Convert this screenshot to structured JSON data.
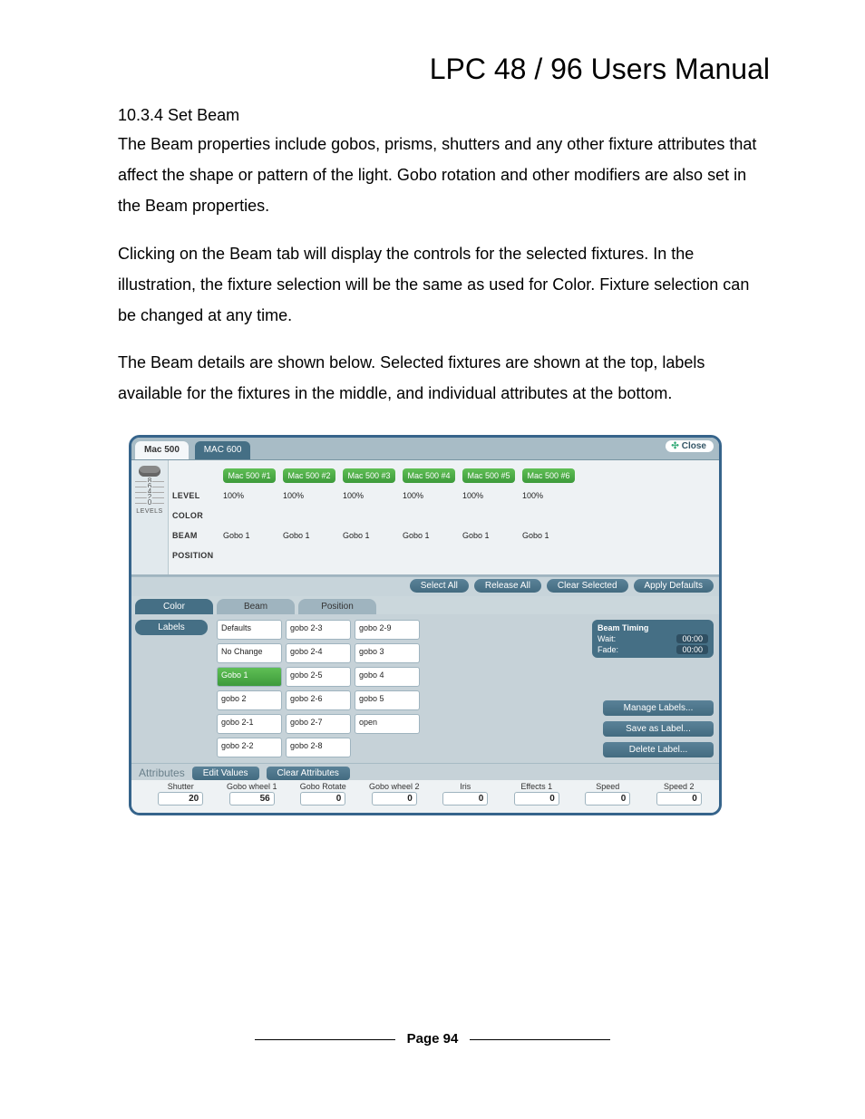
{
  "doc": {
    "title": "LPC 48 / 96 Users Manual",
    "section_number": "10.3.4 Set Beam",
    "para1": "The Beam properties include gobos, prisms, shutters and any other fixture attributes that affect the shape or pattern of the light. Gobo rotation and other modifiers are also set in the Beam properties.",
    "para2": "Clicking on the Beam tab will display the controls for the selected fixtures.  In the illustration, the fixture selection will be the same as used for Color.  Fixture selection can be changed at any time.",
    "para3": "The  Beam details are shown below.  Selected fixtures are shown at the top, labels available for the fixtures in the middle, and individual attributes at the bottom.",
    "page_label": "Page 94"
  },
  "ss": {
    "tabs": {
      "active": "Mac 500",
      "inactive": "MAC 600"
    },
    "close": "Close",
    "level_ticks": [
      "8",
      "6",
      "4",
      "2",
      "0"
    ],
    "levels_label": "LEVELS",
    "row_labels": [
      "LEVEL",
      "COLOR",
      "BEAM",
      "POSITION"
    ],
    "fixtures": [
      "Mac 500 #1",
      "Mac 500 #2",
      "Mac 500 #3",
      "Mac 500 #4",
      "Mac 500 #5",
      "Mac 500 #6"
    ],
    "level_vals": [
      "100%",
      "100%",
      "100%",
      "100%",
      "100%",
      "100%"
    ],
    "beam_vals": [
      "Gobo 1",
      "Gobo 1",
      "Gobo 1",
      "Gobo 1",
      "Gobo 1",
      "Gobo 1"
    ],
    "sel_buttons": [
      "Select All",
      "Release All",
      "Clear Selected",
      "Apply Defaults"
    ],
    "mid_tabs": [
      "Color",
      "Beam",
      "Position"
    ],
    "labels_tab": "Labels",
    "labels_col1": [
      "Defaults",
      "No Change",
      "Gobo 1",
      "gobo 2",
      "gobo 2-1",
      "gobo 2-2"
    ],
    "labels_col2": [
      "gobo 2-3",
      "gobo 2-4",
      "gobo 2-5",
      "gobo 2-6",
      "gobo 2-7",
      "gobo 2-8"
    ],
    "labels_col3": [
      "gobo 2-9",
      "gobo 3",
      "gobo 4",
      "gobo 5",
      "open"
    ],
    "selected_label_index": 2,
    "timing": {
      "title": "Beam Timing",
      "wait_l": "Wait:",
      "wait_v": "00:00",
      "fade_l": "Fade:",
      "fade_v": "00:00"
    },
    "right_buttons": [
      "Manage Labels...",
      "Save as Label...",
      "Delete Label..."
    ],
    "attr_title": "Attributes",
    "attr_buttons": [
      "Edit Values",
      "Clear Attributes"
    ],
    "attrs": [
      {
        "l": "Shutter",
        "v": "20"
      },
      {
        "l": "Gobo wheel 1",
        "v": "56"
      },
      {
        "l": "Gobo Rotate",
        "v": "0"
      },
      {
        "l": "Gobo wheel 2",
        "v": "0"
      },
      {
        "l": "Iris",
        "v": "0"
      },
      {
        "l": "Effects 1",
        "v": "0"
      },
      {
        "l": "Speed",
        "v": "0"
      },
      {
        "l": "Speed 2",
        "v": "0"
      }
    ]
  }
}
